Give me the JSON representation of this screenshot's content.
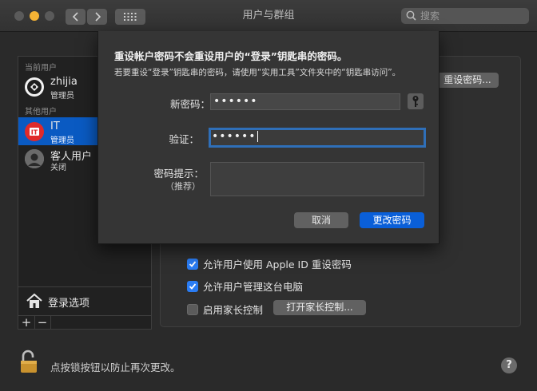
{
  "window": {
    "title": "用户与群组"
  },
  "search": {
    "placeholder": "搜索"
  },
  "sidebar": {
    "current_section": "当前用户",
    "other_section": "其他用户",
    "users": [
      {
        "name": "zhijia",
        "role": "管理员"
      },
      {
        "name": "IT",
        "role": "管理员",
        "selected": true
      },
      {
        "name": "客人用户",
        "role": "关闭"
      }
    ],
    "login_options": "登录选项",
    "add": "+",
    "remove": "−"
  },
  "pane": {
    "reset_password_button": "重设密码...",
    "allow_apple_id_reset": {
      "label": "允许用户使用 Apple ID 重设密码",
      "checked": true
    },
    "allow_admin": {
      "label": "允许用户管理这台电脑",
      "checked": true
    },
    "parental_controls": {
      "label": "启用家长控制",
      "checked": false
    },
    "open_parental_controls": "打开家长控制..."
  },
  "footer": {
    "lock_text": "点按锁按钮以防止再次更改。",
    "help": "?"
  },
  "dialog": {
    "title": "重设帐户密码不会重设用户的“登录”钥匙串的密码。",
    "subtitle": "若要重设“登录”钥匙串的密码，请使用“实用工具”文件夹中的“钥匙串访问”。",
    "new_password_label": "新密码：",
    "new_password_value": "••••••",
    "verify_label": "验证：",
    "verify_value": "••••••",
    "hint_label": "密码提示：",
    "hint_sublabel": "（推荐）",
    "cancel": "取消",
    "confirm": "更改密码"
  },
  "colors": {
    "accent": "#0a5fd8",
    "selection": "#0a5ac2",
    "minimize": "#f5b335"
  }
}
